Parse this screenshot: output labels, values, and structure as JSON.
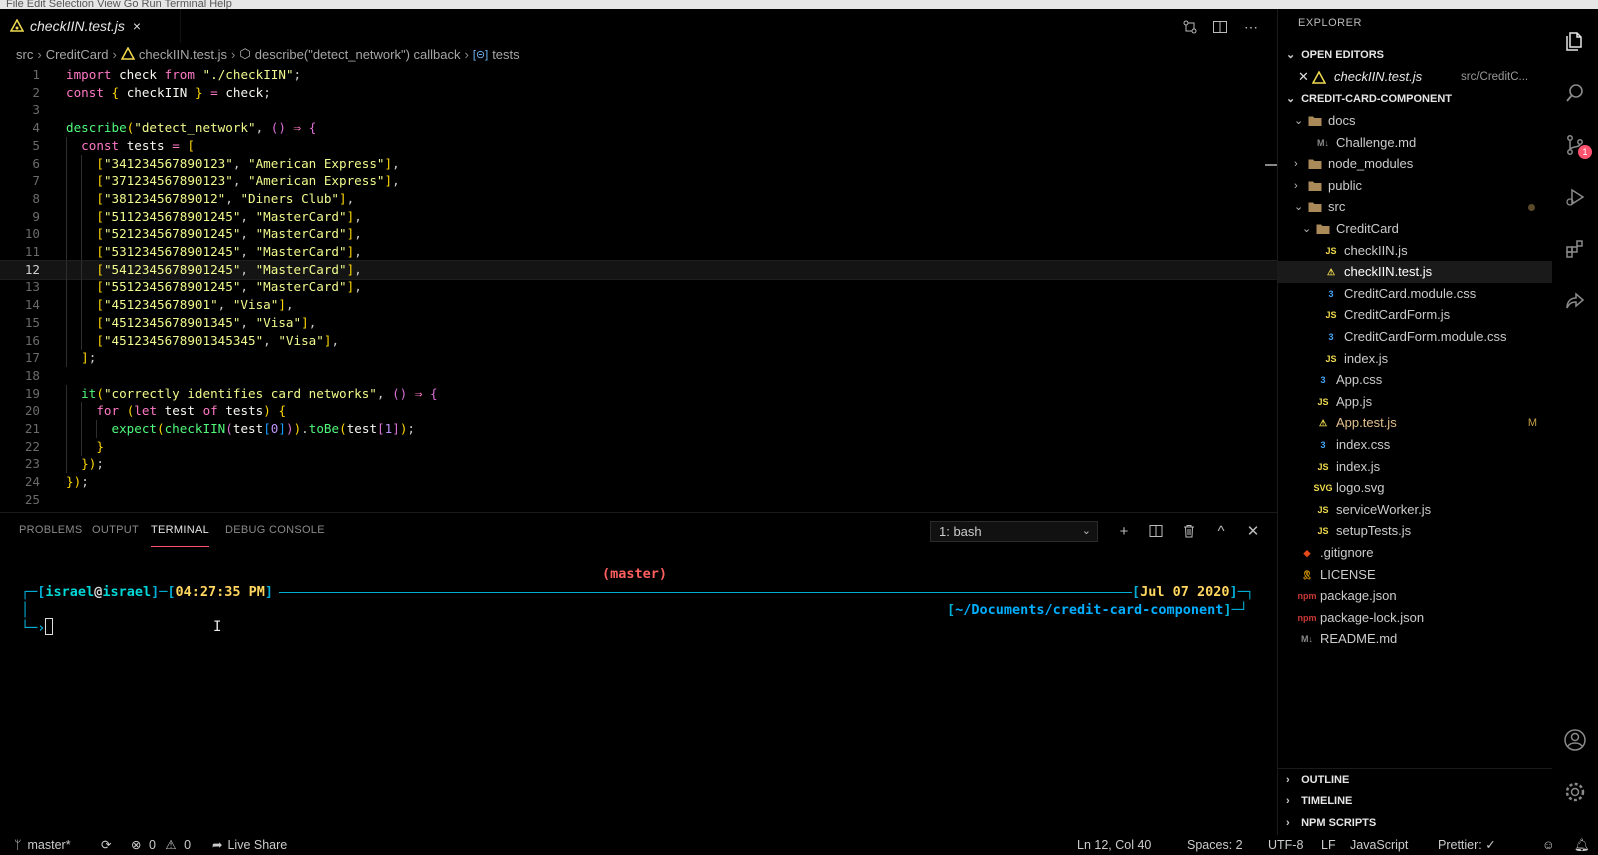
{
  "menubar": {
    "text": "File  Edit  Selection  View  Go  Run  Terminal  Help"
  },
  "tab": {
    "label": "checkIIN.test.js",
    "close": "×"
  },
  "breadcrumb": {
    "items": [
      "src",
      "CreditCard",
      "checkIIN.test.js",
      "describe(\"detect_network\") callback",
      "tests"
    ],
    "sep": "›"
  },
  "editor": {
    "line_numbers": [
      "1",
      "2",
      "3",
      "4",
      "5",
      "6",
      "7",
      "8",
      "9",
      "10",
      "11",
      "12",
      "13",
      "14",
      "15",
      "16",
      "17",
      "18",
      "19",
      "20",
      "21",
      "22",
      "23",
      "24",
      "25"
    ],
    "lines": [
      "import check from \"./checkIIN\";",
      "const { checkIIN } = check;",
      "",
      "describe(\"detect_network\", () => {",
      "  const tests = [",
      "    [\"341234567890123\", \"American Express\"],",
      "    [\"371234567890123\", \"American Express\"],",
      "    [\"38123456789012\", \"Diners Club\"],",
      "    [\"5112345678901245\", \"MasterCard\"],",
      "    [\"5212345678901245\", \"MasterCard\"],",
      "    [\"5312345678901245\", \"MasterCard\"],",
      "    [\"5412345678901245\", \"MasterCard\"],",
      "    [\"5512345678901245\", \"MasterCard\"],",
      "    [\"4512345678901\", \"Visa\"],",
      "    [\"4512345678901345\", \"Visa\"],",
      "    [\"4512345678901345345\", \"Visa\"],",
      "  ];",
      "",
      "  it(\"correctly identifies card networks\", () => {",
      "    for (let test of tests) {",
      "      expect(checkIIN(test[0])).toBe(test[1]);",
      "    }",
      "  });",
      "});",
      ""
    ],
    "current_line": 12
  },
  "panel": {
    "tabs": [
      "PROBLEMS",
      "OUTPUT",
      "TERMINAL",
      "DEBUG CONSOLE"
    ],
    "active_tab": "TERMINAL",
    "terminal_select": "1: bash"
  },
  "terminal": {
    "branch": "(master)",
    "user": "israel",
    "at": "@",
    "host": "israel",
    "time": "04:27:35 PM",
    "date": "Jul 07 2020",
    "cwd": "~/Documents/credit-card-component"
  },
  "sidebar": {
    "title": "EXPLORER",
    "open_editors_label": "OPEN EDITORS",
    "open_editor": {
      "name": "checkIIN.test.js",
      "path": "src/CreditC..."
    },
    "project_label": "CREDIT-CARD-COMPONENT",
    "tree": [
      {
        "label": "docs",
        "kind": "folder",
        "open": true
      },
      {
        "label": "Challenge.md",
        "kind": "md"
      },
      {
        "label": "node_modules",
        "kind": "folder",
        "open": false
      },
      {
        "label": "public",
        "kind": "folder",
        "open": false
      },
      {
        "label": "src",
        "kind": "folder",
        "open": true
      },
      {
        "label": "CreditCard",
        "kind": "folder",
        "open": true
      },
      {
        "label": "checkIIN.js",
        "kind": "js"
      },
      {
        "label": "checkIIN.test.js",
        "kind": "test"
      },
      {
        "label": "CreditCard.module.css",
        "kind": "css"
      },
      {
        "label": "CreditCardForm.js",
        "kind": "js"
      },
      {
        "label": "CreditCardForm.module.css",
        "kind": "css"
      },
      {
        "label": "index.js",
        "kind": "js"
      },
      {
        "label": "App.css",
        "kind": "css"
      },
      {
        "label": "App.js",
        "kind": "js"
      },
      {
        "label": "App.test.js",
        "kind": "test",
        "decoration": "M"
      },
      {
        "label": "index.css",
        "kind": "css"
      },
      {
        "label": "index.js",
        "kind": "js"
      },
      {
        "label": "logo.svg",
        "kind": "svg"
      },
      {
        "label": "serviceWorker.js",
        "kind": "js"
      },
      {
        "label": "setupTests.js",
        "kind": "js"
      },
      {
        "label": ".gitignore",
        "kind": "git"
      },
      {
        "label": "LICENSE",
        "kind": "license"
      },
      {
        "label": "package.json",
        "kind": "npm"
      },
      {
        "label": "package-lock.json",
        "kind": "npm"
      },
      {
        "label": "README.md",
        "kind": "md"
      }
    ],
    "outline_label": "OUTLINE",
    "timeline_label": "TIMELINE",
    "npm_label": "NPM SCRIPTS"
  },
  "activity": {
    "scm_badge": "1"
  },
  "status": {
    "branch": "master*",
    "errors": "0",
    "warnings": "0",
    "live_share": "Live Share",
    "position": "Ln 12, Col 40",
    "spaces": "Spaces: 2",
    "encoding": "UTF-8",
    "eol": "LF",
    "language": "JavaScript",
    "prettier": "Prettier: ✓"
  },
  "colors": {
    "accent_tab_underline": "#ff5370",
    "terminal_border": "#00afd7",
    "terminal_user": "#00d7d7",
    "terminal_date": "#ffd75f",
    "terminal_branch": "#ff5f5f",
    "terminal_cwd": "#00afff"
  }
}
